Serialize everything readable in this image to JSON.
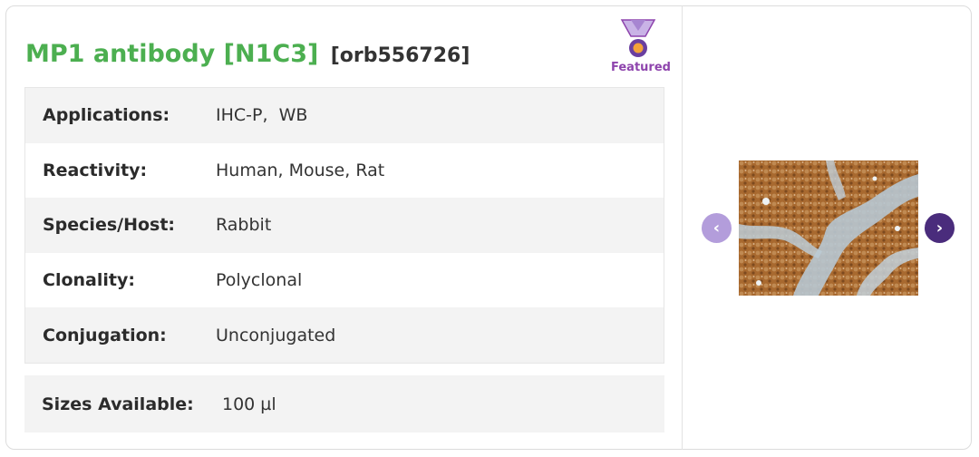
{
  "product": {
    "name": "MP1 antibody [N1C3]",
    "sku": "[orb556726]"
  },
  "badge": {
    "label": "Featured",
    "icon": "medal-icon",
    "color": "#8e44ad"
  },
  "specs": [
    {
      "label": "Applications:",
      "value": "IHC-P,  WB"
    },
    {
      "label": "Reactivity:",
      "value": "Human, Mouse, Rat"
    },
    {
      "label": "Species/Host:",
      "value": "Rabbit"
    },
    {
      "label": "Clonality:",
      "value": "Polyclonal"
    },
    {
      "label": "Conjugation:",
      "value": "Unconjugated"
    }
  ],
  "sizes": {
    "label": "Sizes Available:",
    "value": "100 µl"
  },
  "gallery": {
    "prev_icon": "chevron-left-icon",
    "next_icon": "chevron-right-icon",
    "prev_glyph": "‹",
    "next_glyph": "›"
  },
  "colors": {
    "title": "#4caf50",
    "accent": "#4a2c7c",
    "accent_light": "#b39ddb"
  }
}
